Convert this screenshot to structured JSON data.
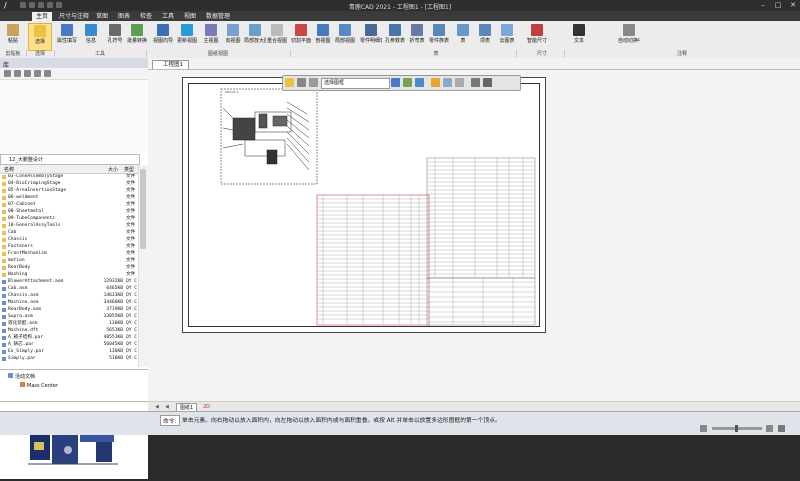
{
  "app": {
    "title": "青鹿CAD 2021 - 工程图1 - [工程图1]",
    "logo_glyph": "/"
  },
  "window_controls": [
    "–",
    "□",
    "✕"
  ],
  "menu_tabs": [
    "主页",
    "尺寸与注释",
    "草图",
    "图表",
    "检查",
    "工具",
    "视图",
    "数据管理"
  ],
  "ribbon": {
    "buttons": [
      {
        "label": "粘贴",
        "icon": "clipboard-icon",
        "color": "#c9a35c"
      },
      {
        "label": "选择",
        "icon": "cursor-icon",
        "color": "#f0c040",
        "selected": true
      },
      {
        "label": "属性填写",
        "icon": "form-icon",
        "color": "#4a78c8"
      },
      {
        "label": "信息",
        "icon": "info-icon",
        "color": "#3a8ad0"
      },
      {
        "label": "孔符号",
        "icon": "hole-icon",
        "color": "#6a6a6a"
      },
      {
        "label": "批量转换",
        "icon": "convert-icon",
        "color": "#5aa050"
      },
      {
        "label": "视图向导",
        "icon": "wizard-icon",
        "color": "#3a70b8"
      },
      {
        "label": "更新视图",
        "icon": "refresh-icon",
        "color": "#2a9ad8"
      },
      {
        "label": "主视图",
        "icon": "view-icon",
        "color": "#7a7ab8"
      },
      {
        "label": "向视图",
        "icon": "direction-view-icon",
        "color": "#7aa0d0"
      },
      {
        "label": "局部放大图",
        "icon": "detail-view-icon",
        "color": "#6aa0c8"
      },
      {
        "label": "重合视图",
        "icon": "overlay-view-icon",
        "color": "#bbbbbb"
      },
      {
        "label": "切割平面",
        "icon": "cutting-plane-icon",
        "color": "#c84848"
      },
      {
        "label": "剖视图",
        "icon": "section-view-icon",
        "color": "#4878c0"
      },
      {
        "label": "局部视图",
        "icon": "broken-view-icon",
        "color": "#5888c8"
      },
      {
        "label": "零件明细表",
        "icon": "bom-icon",
        "color": "#486898"
      },
      {
        "label": "孔参数表",
        "icon": "hole-table-icon",
        "color": "#4878a8"
      },
      {
        "label": "折弯表",
        "icon": "bend-table-icon",
        "color": "#6878a8"
      },
      {
        "label": "零件族表",
        "icon": "family-table-icon",
        "color": "#5888b8"
      },
      {
        "label": "表",
        "icon": "table-icon",
        "color": "#6898c8"
      },
      {
        "label": "项表",
        "icon": "item-table-icon",
        "color": "#5888b8"
      },
      {
        "label": "云图表",
        "icon": "cloud-table-icon",
        "color": "#78a8d8"
      },
      {
        "label": "智能尺寸",
        "icon": "smart-dimension-icon",
        "color": "#c04040"
      },
      {
        "label": "文本",
        "icon": "text-icon",
        "color": "#333333"
      },
      {
        "label": "自动切换中心线",
        "icon": "centerline-icon",
        "color": "#888888"
      }
    ],
    "groups": [
      "剪贴板",
      "选择",
      "工具",
      "图纸视图",
      "表",
      "尺寸",
      "注释"
    ]
  },
  "left_pane": {
    "title": "库",
    "path": "12_大鹏整设计",
    "columns": [
      "名称",
      "大小",
      "类型"
    ],
    "files": [
      {
        "name": "03-ConeAssemblyStage",
        "size": "",
        "type": "文件",
        "folder": true
      },
      {
        "name": "04-BioCrimpingStage",
        "size": "",
        "type": "文件",
        "folder": true
      },
      {
        "name": "05-AreaInsertionStage",
        "size": "",
        "type": "文件",
        "folder": true
      },
      {
        "name": "06-weldment",
        "size": "",
        "type": "文件",
        "folder": true
      },
      {
        "name": "07-Cabinet",
        "size": "",
        "type": "文件",
        "folder": true
      },
      {
        "name": "08-Sheetmetal",
        "size": "",
        "type": "文件",
        "folder": true
      },
      {
        "name": "09-TubeComponents",
        "size": "",
        "type": "文件",
        "folder": true
      },
      {
        "name": "10-GeneralAssyTools",
        "size": "",
        "type": "文件",
        "folder": true
      },
      {
        "name": "Cab",
        "size": "",
        "type": "文件",
        "folder": true
      },
      {
        "name": "Chassis",
        "size": "",
        "type": "文件",
        "folder": true
      },
      {
        "name": "Fasteners",
        "size": "",
        "type": "文件",
        "folder": true
      },
      {
        "name": "FrontMechanism",
        "size": "",
        "type": "文件",
        "folder": true
      },
      {
        "name": "motion",
        "size": "",
        "type": "文件",
        "folder": true
      },
      {
        "name": "RearBody",
        "size": "",
        "type": "文件",
        "folder": true
      },
      {
        "name": "Washing",
        "size": "",
        "type": "文件",
        "folder": true
      },
      {
        "name": "BlowerAttachment.asm",
        "size": "12932KB",
        "type": "QY C",
        "folder": false
      },
      {
        "name": "Cab.asm",
        "size": "6465KB",
        "type": "QY C",
        "folder": false
      },
      {
        "name": "Chassis.asm",
        "size": "14633KB",
        "type": "QY C",
        "folder": false
      },
      {
        "name": "Machine.asm",
        "size": "34466KB",
        "type": "QY C",
        "folder": false
      },
      {
        "name": "RearBody.asm",
        "size": "3719KB",
        "type": "QY C",
        "folder": false
      },
      {
        "name": "Supra.asm",
        "size": "33055KB",
        "type": "QY C",
        "folder": false
      },
      {
        "name": "液化装配.asm",
        "size": "136KB",
        "type": "QY C",
        "folder": false
      },
      {
        "name": "Machine.dft",
        "size": "5651KB",
        "type": "QY C",
        "folder": false
      },
      {
        "name": "A_箱子结构.par",
        "size": "40551KB",
        "type": "QY C",
        "folder": false
      },
      {
        "name": "A_铸芯.par",
        "size": "56045KB",
        "type": "QY C",
        "folder": false
      },
      {
        "name": "Ex_Simply.par",
        "size": "136KB",
        "type": "QY C",
        "folder": false
      },
      {
        "name": "Simply.par",
        "size": "516KB",
        "type": "QY C",
        "folder": false
      }
    ],
    "tree": {
      "root": "活动文档",
      "child": "Mass Center"
    }
  },
  "document": {
    "tab_label": "工程图1",
    "view_label": "GROUP 2",
    "sheet_tabs": [
      "图纸1",
      "2D"
    ],
    "floating_bar": {
      "select_value": "选择图框"
    }
  },
  "status": {
    "label": "命令:",
    "message": "单击元素。向右拖动以放入面积内，向左拖动以放入面积内或与面积重叠。或按 Alt 并单击以放置多边形图框的第一个顶点。"
  }
}
